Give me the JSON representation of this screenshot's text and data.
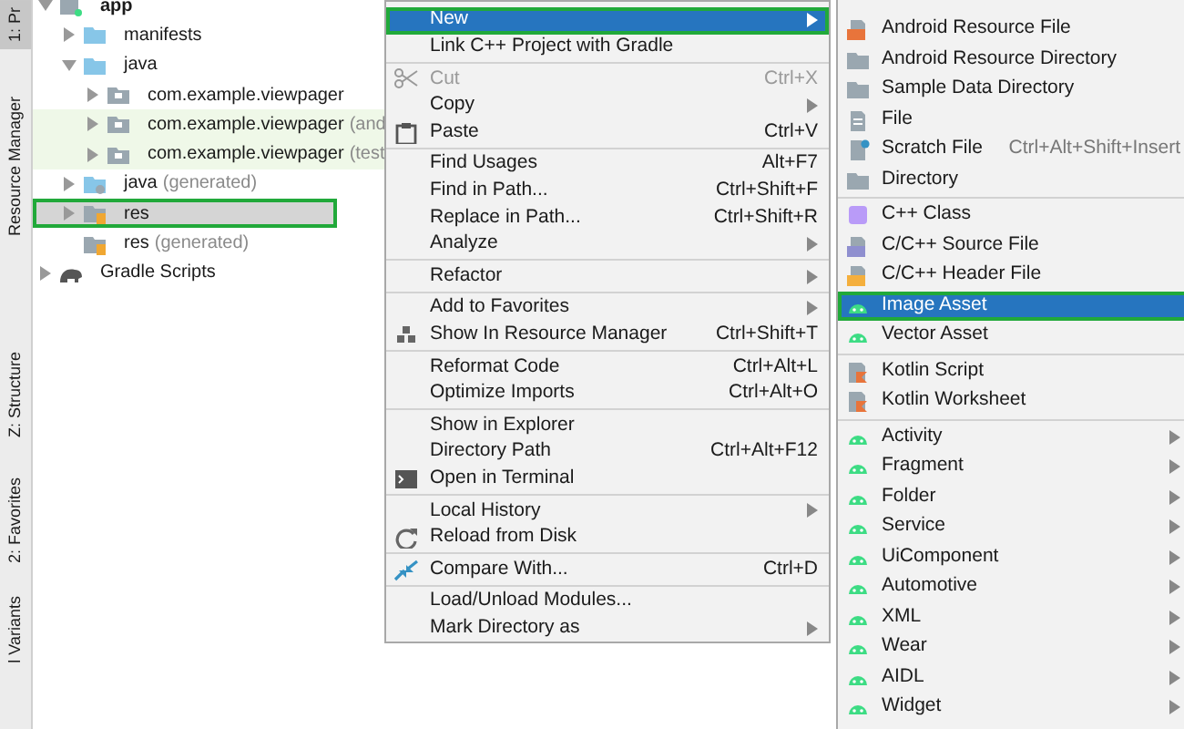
{
  "tool_strip": [
    {
      "label": "1: Pr",
      "selected": true
    },
    {
      "label": "Resource Manager",
      "selected": false
    },
    {
      "label": "Z: Structure",
      "selected": false
    },
    {
      "label": "2: Favorites",
      "selected": false
    },
    {
      "label": "l Variants",
      "selected": false
    }
  ],
  "project_tree": [
    {
      "label": "app",
      "expanded": true,
      "selected": false,
      "children": [
        {
          "label": "manifests",
          "expanded": false,
          "selected": false
        },
        {
          "label": "java",
          "expanded": true,
          "selected": false,
          "children": [
            {
              "label": "com.example.viewpager",
              "expanded": false,
              "selected": false
            },
            {
              "label": "com.example.viewpager",
              "note": "(and",
              "expanded": false,
              "selected": false
            },
            {
              "label": "com.example.viewpager",
              "note": "(test",
              "expanded": false,
              "selected": false
            }
          ]
        },
        {
          "label": "java",
          "note": "(generated)",
          "expanded": false,
          "selected": false
        },
        {
          "label": "res",
          "expanded": false,
          "selected": true
        },
        {
          "label": "res",
          "note": "(generated)",
          "selected": false
        }
      ]
    },
    {
      "label": "Gradle Scripts",
      "expanded": false,
      "selected": false
    }
  ],
  "context_menu": [
    [
      {
        "label": "New",
        "submenu": true,
        "selected": true,
        "disabled": false
      },
      {
        "label": "Link C++ Project with Gradle",
        "selected": false,
        "disabled": false
      }
    ],
    [
      {
        "label": "Cut",
        "shortcut": "Ctrl+X",
        "selected": false,
        "disabled": true
      },
      {
        "label": "Copy",
        "submenu": true,
        "selected": false,
        "disabled": false
      },
      {
        "label": "Paste",
        "shortcut": "Ctrl+V",
        "selected": false,
        "disabled": false
      }
    ],
    [
      {
        "label": "Find Usages",
        "shortcut": "Alt+F7",
        "selected": false,
        "disabled": false
      },
      {
        "label": "Find in Path...",
        "shortcut": "Ctrl+Shift+F",
        "selected": false,
        "disabled": false
      },
      {
        "label": "Replace in Path...",
        "shortcut": "Ctrl+Shift+R",
        "selected": false,
        "disabled": false
      },
      {
        "label": "Analyze",
        "submenu": true,
        "selected": false,
        "disabled": false
      }
    ],
    [
      {
        "label": "Refactor",
        "submenu": true,
        "selected": false,
        "disabled": false
      }
    ],
    [
      {
        "label": "Add to Favorites",
        "submenu": true,
        "selected": false,
        "disabled": false
      },
      {
        "label": "Show In Resource Manager",
        "shortcut": "Ctrl+Shift+T",
        "selected": false,
        "disabled": false
      }
    ],
    [
      {
        "label": "Reformat Code",
        "shortcut": "Ctrl+Alt+L",
        "selected": false,
        "disabled": false
      },
      {
        "label": "Optimize Imports",
        "shortcut": "Ctrl+Alt+O",
        "selected": false,
        "disabled": false
      }
    ],
    [
      {
        "label": "Show in Explorer",
        "selected": false,
        "disabled": false
      },
      {
        "label": "Directory Path",
        "shortcut": "Ctrl+Alt+F12",
        "selected": false,
        "disabled": false
      },
      {
        "label": "Open in Terminal",
        "selected": false,
        "disabled": false
      }
    ],
    [
      {
        "label": "Local History",
        "submenu": true,
        "selected": false,
        "disabled": false
      },
      {
        "label": "Reload from Disk",
        "selected": false,
        "disabled": false
      }
    ],
    [
      {
        "label": "Compare With...",
        "shortcut": "Ctrl+D",
        "selected": false,
        "disabled": false
      }
    ],
    [
      {
        "label": "Load/Unload Modules...",
        "selected": false,
        "disabled": false
      },
      {
        "label": "Mark Directory as",
        "submenu": true,
        "selected": false,
        "disabled": false
      }
    ]
  ],
  "new_submenu": [
    [
      {
        "label": "Android Resource File",
        "selected": false
      },
      {
        "label": "Android Resource Directory",
        "selected": false
      },
      {
        "label": "Sample Data Directory",
        "selected": false
      },
      {
        "label": "File",
        "selected": false
      },
      {
        "label": "Scratch File",
        "shortcut": "Ctrl+Alt+Shift+Insert",
        "selected": false
      },
      {
        "label": "Directory",
        "selected": false
      }
    ],
    [
      {
        "label": "C++ Class",
        "selected": false
      },
      {
        "label": "C/C++ Source File",
        "selected": false
      },
      {
        "label": "C/C++ Header File",
        "selected": false
      },
      {
        "label": "Image Asset",
        "selected": true
      },
      {
        "label": "Vector Asset",
        "selected": false
      }
    ],
    [
      {
        "label": "Kotlin Script",
        "selected": false
      },
      {
        "label": "Kotlin Worksheet",
        "selected": false
      }
    ],
    [
      {
        "label": "Activity",
        "submenu": true,
        "selected": false
      },
      {
        "label": "Fragment",
        "submenu": true,
        "selected": false
      },
      {
        "label": "Folder",
        "submenu": true,
        "selected": false
      },
      {
        "label": "Service",
        "submenu": true,
        "selected": false
      },
      {
        "label": "UiComponent",
        "submenu": true,
        "selected": false
      },
      {
        "label": "Automotive",
        "submenu": true,
        "selected": false
      },
      {
        "label": "XML",
        "submenu": true,
        "selected": false
      },
      {
        "label": "Wear",
        "submenu": true,
        "selected": false
      },
      {
        "label": "AIDL",
        "submenu": true,
        "selected": false
      },
      {
        "label": "Widget",
        "submenu": true,
        "selected": false
      }
    ]
  ]
}
